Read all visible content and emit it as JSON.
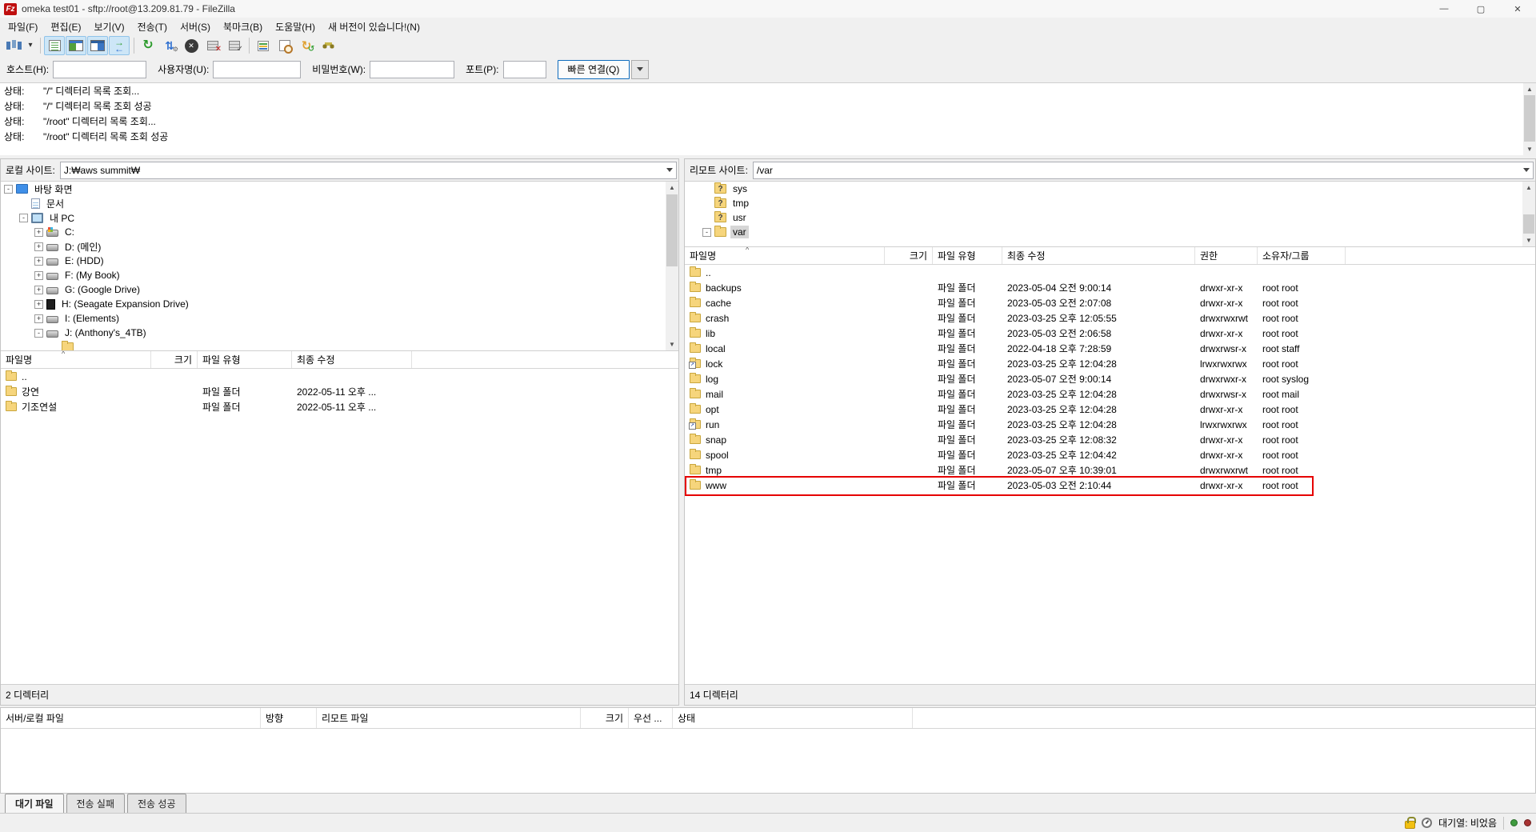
{
  "window": {
    "app_icon": "Fz",
    "title": "omeka test01 - sftp://root@13.209.81.79 - FileZilla",
    "minimize": "—",
    "maximize": "▢",
    "close": "✕"
  },
  "menu": {
    "items": [
      {
        "label": "파일(F)"
      },
      {
        "label": "편집(E)"
      },
      {
        "label": "보기(V)"
      },
      {
        "label": "전송(T)"
      },
      {
        "label": "서버(S)"
      },
      {
        "label": "북마크(B)"
      },
      {
        "label": "도움말(H)"
      },
      {
        "label": "새 버전이 있습니다!(N)"
      }
    ]
  },
  "toolbar": {
    "items": [
      {
        "name": "site-manager-button",
        "btncls": "",
        "cls": "ic-sitemgr",
        "glyph": ""
      },
      {
        "name": "site-manager-dropdown",
        "btncls": "narrow",
        "cls": "ic-dropdown",
        "glyph": "▾"
      },
      {
        "name": "toolbar-separator",
        "btncls": "sep",
        "cls": "",
        "glyph": ""
      },
      {
        "name": "toggle-message-log-button",
        "btncls": "active",
        "cls": "ic-log",
        "glyph": ""
      },
      {
        "name": "toggle-local-tree-button",
        "btncls": "active",
        "cls": "ic-ltree",
        "glyph": ""
      },
      {
        "name": "toggle-remote-tree-button",
        "btncls": "active",
        "cls": "ic-rtree",
        "glyph": ""
      },
      {
        "name": "toggle-transfer-queue-button",
        "btncls": "active",
        "cls": "ic-queue",
        "glyph": ""
      },
      {
        "name": "toolbar-separator",
        "btncls": "sep",
        "cls": "",
        "glyph": ""
      },
      {
        "name": "refresh-button",
        "btncls": "",
        "cls": "ic-refresh",
        "glyph": "↻"
      },
      {
        "name": "process-queue-button",
        "btncls": "",
        "cls": "ic-process",
        "glyph": "⇅"
      },
      {
        "name": "cancel-operation-button",
        "btncls": "",
        "cls": "ic-cancel",
        "glyph": "✕"
      },
      {
        "name": "disconnect-button",
        "btncls": "",
        "cls": "ic-disconnect",
        "glyph": ""
      },
      {
        "name": "reconnect-button",
        "btncls": "",
        "cls": "ic-reconnect",
        "glyph": ""
      },
      {
        "name": "toolbar-separator",
        "btncls": "sep",
        "cls": "",
        "glyph": ""
      },
      {
        "name": "filter-button",
        "btncls": "",
        "cls": "ic-filter",
        "glyph": ""
      },
      {
        "name": "directory-compare-button",
        "btncls": "",
        "cls": "ic-compare",
        "glyph": ""
      },
      {
        "name": "sync-browsing-button",
        "btncls": "",
        "cls": "ic-sync",
        "glyph": "↻"
      },
      {
        "name": "find-files-button",
        "btncls": "",
        "cls": "ic-find",
        "glyph": ""
      }
    ]
  },
  "quick": {
    "host_label": "호스트(H):",
    "host_value": "",
    "user_label": "사용자명(U):",
    "user_value": "",
    "pass_label": "비밀번호(W):",
    "pass_value": "",
    "port_label": "포트(P):",
    "port_value": "",
    "connect_label": "빠른 연결(Q)"
  },
  "log": {
    "entries": [
      {
        "key": "상태:",
        "message": "\"/\" 디렉터리 목록 조회..."
      },
      {
        "key": "상태:",
        "message": "\"/\" 디렉터리 목록 조회 성공"
      },
      {
        "key": "상태:",
        "message": "\"/root\" 디렉터리 목록 조회..."
      },
      {
        "key": "상태:",
        "message": "\"/root\" 디렉터리 목록 조회 성공"
      }
    ]
  },
  "local": {
    "site_label": "로컬 사이트:",
    "site_path": "J:₩aws summit₩",
    "tree": [
      {
        "exp": "-",
        "icon": "desktop",
        "label": "바탕 화면",
        "cls": "lvl0"
      },
      {
        "exp": "",
        "icon": "doc",
        "label": "문서",
        "cls": "lvl1"
      },
      {
        "exp": "-",
        "icon": "pc",
        "label": "내 PC",
        "cls": "lvl1"
      },
      {
        "exp": "+",
        "icon": "windisk",
        "label": "C:",
        "cls": "lvl2"
      },
      {
        "exp": "+",
        "icon": "disk",
        "label": "D: (메인)",
        "cls": "lvl2"
      },
      {
        "exp": "+",
        "icon": "disk",
        "label": "E: (HDD)",
        "cls": "lvl2"
      },
      {
        "exp": "+",
        "icon": "disk",
        "label": "F: (My Book)",
        "cls": "lvl2"
      },
      {
        "exp": "+",
        "icon": "disk",
        "label": "G: (Google Drive)",
        "cls": "lvl2"
      },
      {
        "exp": "+",
        "icon": "extdisk",
        "label": "H: (Seagate Expansion Drive)",
        "cls": "lvl2"
      },
      {
        "exp": "+",
        "icon": "disk",
        "label": "I: (Elements)",
        "cls": "lvl2"
      },
      {
        "exp": "-",
        "icon": "disk",
        "label": "J: (Anthony's_4TB)",
        "cls": "lvl2"
      },
      {
        "exp": "",
        "icon": "folder",
        "label": "",
        "cls": "lvl3"
      }
    ],
    "headers": {
      "name": "파일명",
      "size": "크기",
      "type": "파일 유형",
      "modified": "최종 수정"
    },
    "sort_mark": "^",
    "rows": [
      {
        "icon": "folder",
        "name": "..",
        "size": "",
        "type": "",
        "modified": "",
        "cls": ""
      },
      {
        "icon": "folder",
        "name": "강연",
        "size": "",
        "type": "파일 폴더",
        "modified": "2022-05-11 오후 ...",
        "cls": ""
      },
      {
        "icon": "folder",
        "name": "기조연설",
        "size": "",
        "type": "파일 폴더",
        "modified": "2022-05-11 오후 ...",
        "cls": ""
      }
    ],
    "status": "2 디렉터리"
  },
  "remote": {
    "site_label": "리모트 사이트:",
    "site_path": "/var",
    "tree": [
      {
        "exp": "",
        "icon": "qfolder",
        "label": "sys",
        "cls": "rlvl"
      },
      {
        "exp": "",
        "icon": "qfolder",
        "label": "tmp",
        "cls": "rlvl"
      },
      {
        "exp": "",
        "icon": "qfolder",
        "label": "usr",
        "cls": "rlvl"
      },
      {
        "exp": "-",
        "icon": "folder",
        "label": "var",
        "cls": "rlvl selected"
      }
    ],
    "headers": {
      "name": "파일명",
      "size": "크기",
      "type": "파일 유형",
      "modified": "최종 수정",
      "perms": "권한",
      "owner": "소유자/그룹"
    },
    "sort_mark": "^",
    "rows": [
      {
        "icon": "folder",
        "name": "..",
        "size": "",
        "type": "",
        "modified": "",
        "perms": "",
        "owner": "",
        "cls": ""
      },
      {
        "icon": "folder",
        "name": "backups",
        "size": "",
        "type": "파일 폴더",
        "modified": "2023-05-04 오전 9:00:14",
        "perms": "drwxr-xr-x",
        "owner": "root root",
        "cls": ""
      },
      {
        "icon": "folder",
        "name": "cache",
        "size": "",
        "type": "파일 폴더",
        "modified": "2023-05-03 오전 2:07:08",
        "perms": "drwxr-xr-x",
        "owner": "root root",
        "cls": ""
      },
      {
        "icon": "folder",
        "name": "crash",
        "size": "",
        "type": "파일 폴더",
        "modified": "2023-03-25 오후 12:05:55",
        "perms": "drwxrwxrwt",
        "owner": "root root",
        "cls": ""
      },
      {
        "icon": "folder",
        "name": "lib",
        "size": "",
        "type": "파일 폴더",
        "modified": "2023-05-03 오전 2:06:58",
        "perms": "drwxr-xr-x",
        "owner": "root root",
        "cls": ""
      },
      {
        "icon": "folder",
        "name": "local",
        "size": "",
        "type": "파일 폴더",
        "modified": "2022-04-18 오후 7:28:59",
        "perms": "drwxrwsr-x",
        "owner": "root staff",
        "cls": ""
      },
      {
        "icon": "symfolder",
        "name": "lock",
        "size": "",
        "type": "파일 폴더",
        "modified": "2023-03-25 오후 12:04:28",
        "perms": "lrwxrwxrwx",
        "owner": "root root",
        "cls": ""
      },
      {
        "icon": "folder",
        "name": "log",
        "size": "",
        "type": "파일 폴더",
        "modified": "2023-05-07 오전 9:00:14",
        "perms": "drwxrwxr-x",
        "owner": "root syslog",
        "cls": ""
      },
      {
        "icon": "folder",
        "name": "mail",
        "size": "",
        "type": "파일 폴더",
        "modified": "2023-03-25 오후 12:04:28",
        "perms": "drwxrwsr-x",
        "owner": "root mail",
        "cls": ""
      },
      {
        "icon": "folder",
        "name": "opt",
        "size": "",
        "type": "파일 폴더",
        "modified": "2023-03-25 오후 12:04:28",
        "perms": "drwxr-xr-x",
        "owner": "root root",
        "cls": ""
      },
      {
        "icon": "symfolder",
        "name": "run",
        "size": "",
        "type": "파일 폴더",
        "modified": "2023-03-25 오후 12:04:28",
        "perms": "lrwxrwxrwx",
        "owner": "root root",
        "cls": ""
      },
      {
        "icon": "folder",
        "name": "snap",
        "size": "",
        "type": "파일 폴더",
        "modified": "2023-03-25 오후 12:08:32",
        "perms": "drwxr-xr-x",
        "owner": "root root",
        "cls": ""
      },
      {
        "icon": "folder",
        "name": "spool",
        "size": "",
        "type": "파일 폴더",
        "modified": "2023-03-25 오후 12:04:42",
        "perms": "drwxr-xr-x",
        "owner": "root root",
        "cls": ""
      },
      {
        "icon": "folder",
        "name": "tmp",
        "size": "",
        "type": "파일 폴더",
        "modified": "2023-05-07 오후 10:39:01",
        "perms": "drwxrwxrwt",
        "owner": "root root",
        "cls": ""
      },
      {
        "icon": "folder",
        "name": "www",
        "size": "",
        "type": "파일 폴더",
        "modified": "2023-05-03 오전 2:10:44",
        "perms": "drwxr-xr-x",
        "owner": "root root",
        "cls": "highlighted"
      }
    ],
    "status": "14 디렉터리"
  },
  "queue": {
    "headers": [
      "서버/로컬 파일",
      "방향",
      "리모트 파일",
      "크기",
      "우선 ...",
      "상태"
    ],
    "tabs": [
      {
        "label": "대기 파일",
        "cls": "active"
      },
      {
        "label": "전송 실패",
        "cls": ""
      },
      {
        "label": "전송 성공",
        "cls": ""
      }
    ]
  },
  "statusbar": {
    "queue_status": "대기열: 비었음"
  }
}
